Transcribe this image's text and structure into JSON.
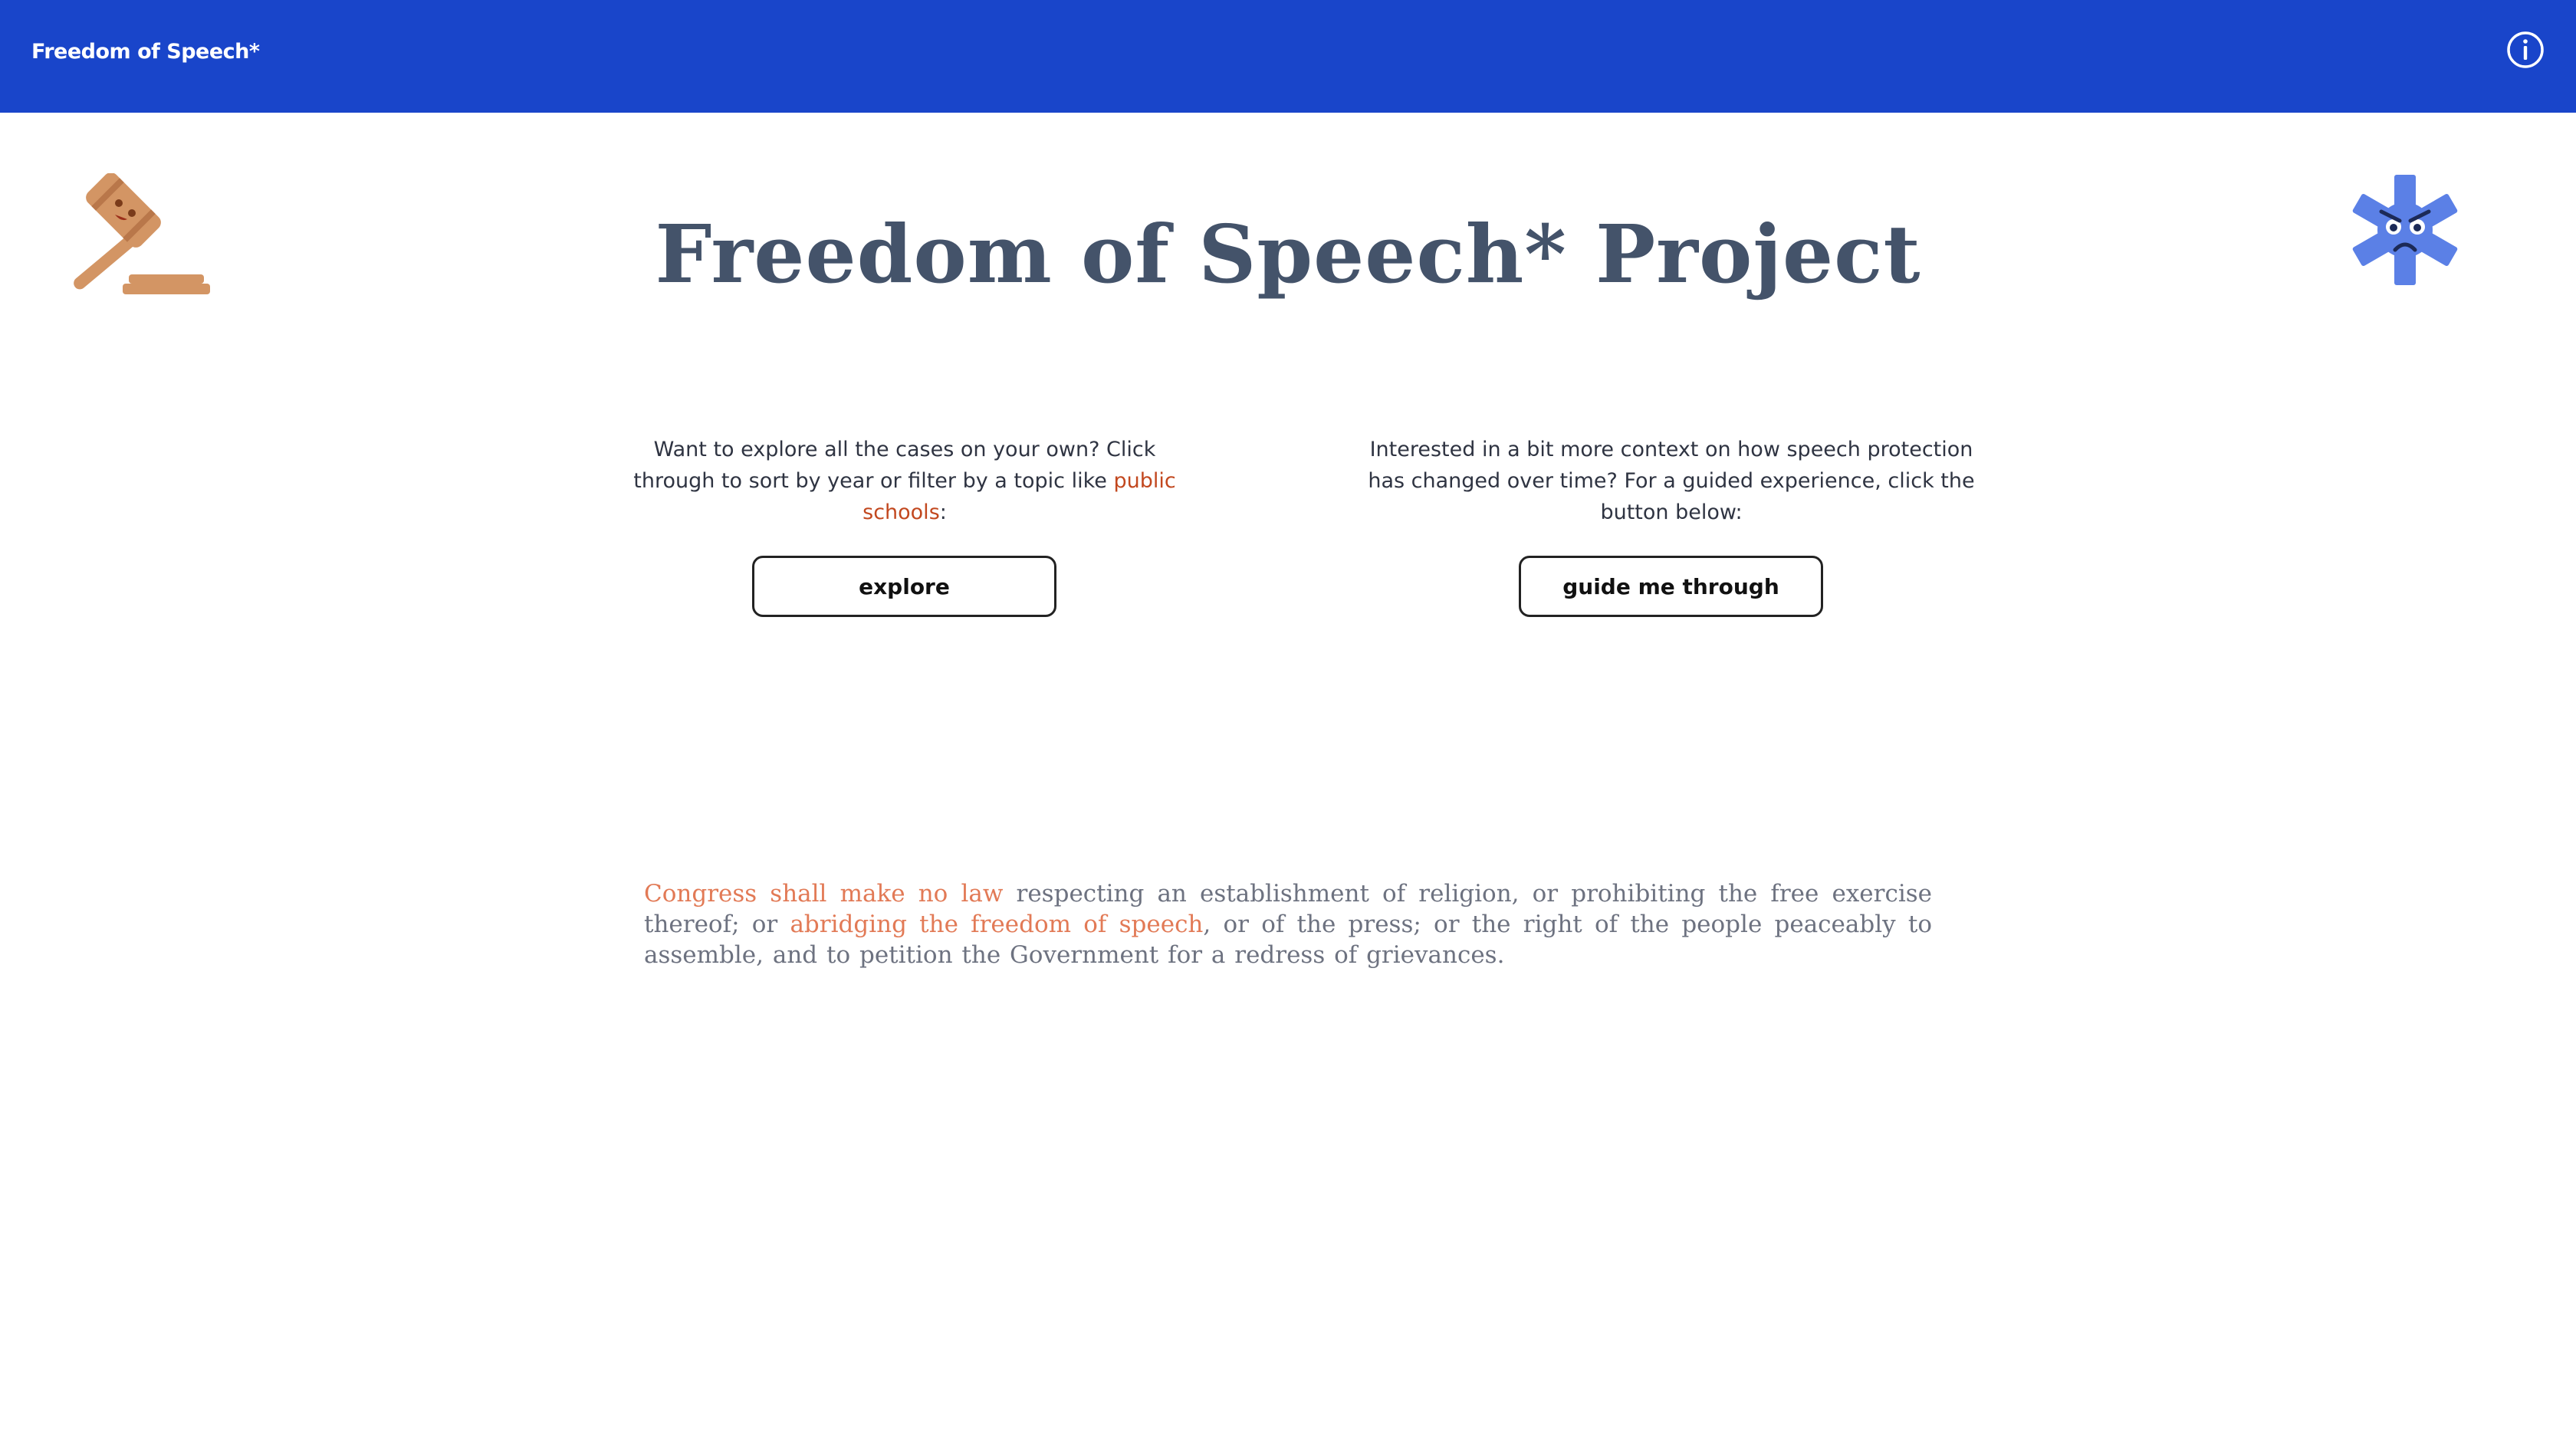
{
  "topbar": {
    "brand": "Freedom of Speech*",
    "info_icon": "info-icon",
    "background": "#1945ca"
  },
  "header": {
    "title": "Freedom of Speech* Project",
    "left_icon": "gavel-icon",
    "right_icon": "angry-asterisk-icon"
  },
  "explore_section": {
    "prompt_before": "Want to explore all the cases on your own? Click through to sort by year or filter by a topic like ",
    "link_text": "public schools",
    "prompt_after": ":",
    "button_label": "explore"
  },
  "guide_section": {
    "prompt": "Interested in a bit more context on how speech protection has changed over time? For a guided experience, click the button below:",
    "button_label": "guide me through"
  },
  "amendment": {
    "part1_highlight": "Congress shall make no law",
    "part2": " respecting an establishment of religion, or prohibiting the free exercise thereof; or ",
    "part3_highlight": "abridging the freedom of speech",
    "part4": ", or of the press; or the right of the people peaceably to assemble, and to petition the Government for a redress of grievances."
  },
  "colors": {
    "accent": "#c2481f",
    "highlight": "#e27a56",
    "gavel": "#d39564",
    "asterisk": "#5b80e6"
  }
}
